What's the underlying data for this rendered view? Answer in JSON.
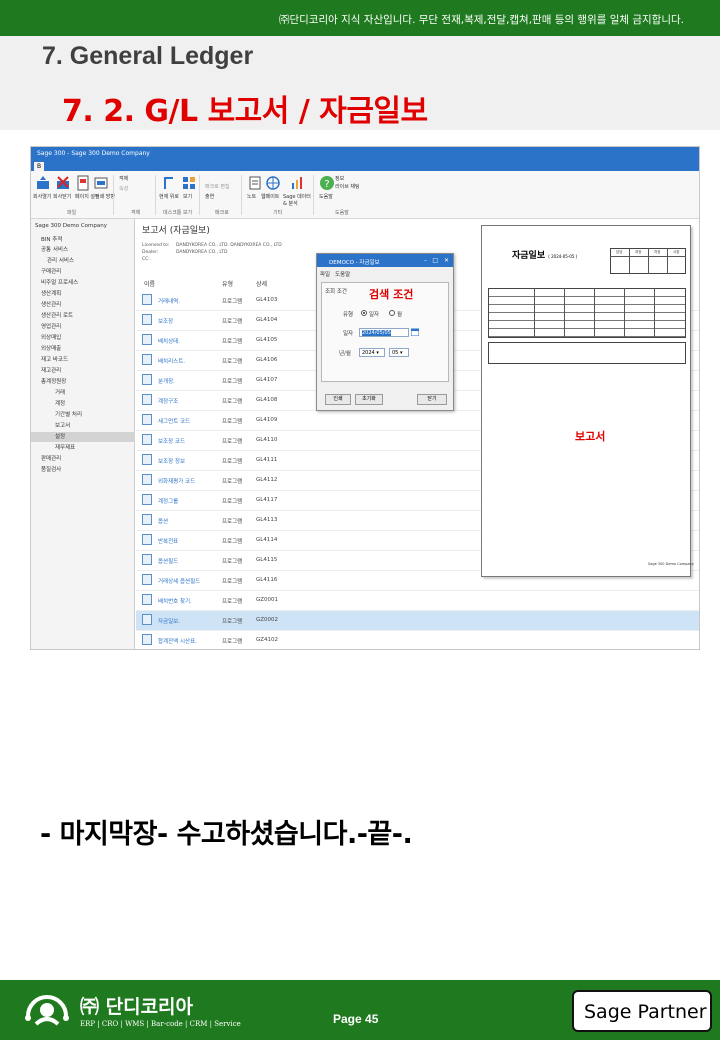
{
  "header": {
    "notice": "㈜단디코리아 지식 자산입니다. 무단 전재,복제,전달,캡쳐,판매 등의 행위를 일체 금지합니다.",
    "chapter": "7. General Ledger",
    "section": "7. 2. G/L 보고서 / 자금일보"
  },
  "screenshot": {
    "window_title": "Sage 300 - Sage 300 Demo Company",
    "home_tab": "B",
    "ribbon": {
      "buttons": [
        {
          "label": "회사열기",
          "icon": "open-company-icon"
        },
        {
          "label": "회사닫기",
          "icon": "close-company-icon"
        },
        {
          "label": "페이지 설정",
          "icon": "page-setup-icon"
        },
        {
          "label": "인쇄 방향",
          "icon": "print-orientation-icon"
        },
        {
          "label": "객체",
          "icon": "object-icon"
        },
        {
          "label": "속성",
          "icon": "properties-icon"
        },
        {
          "label": "현재 위로",
          "icon": "move-up-icon"
        },
        {
          "label": "보기",
          "icon": "view-icon"
        },
        {
          "label": "매크로 편집",
          "icon": "macro-edit-icon"
        },
        {
          "label": "출연",
          "icon": "macro-run-icon"
        },
        {
          "label": "노트",
          "icon": "note-icon"
        },
        {
          "label": "웹페이트",
          "icon": "web-icon"
        },
        {
          "label": "Sage 데이터 & 분석",
          "icon": "analytics-icon"
        },
        {
          "label": "도움말",
          "icon": "help-icon"
        },
        {
          "label": "정보",
          "icon": "info-icon"
        },
        {
          "label": "라이브 채팅",
          "icon": "live-chat-icon"
        }
      ],
      "groups": [
        "파일",
        "객체",
        "데스크톱 보기",
        "매크로",
        "기타",
        "도움말"
      ]
    },
    "sidebar": {
      "root": "Sage 300 Demo Company",
      "items": [
        "BIN 추적",
        "공통 서비스",
        "관리 서비스",
        "구매관리",
        "비주얼 프로세스",
        "생산계획",
        "생산관리",
        "생산관리 로트",
        "영업관리",
        "외상매입",
        "외상매출",
        "재고 바코드",
        "재고관리",
        "총계정원장"
      ],
      "sub_items": [
        "거래",
        "계정",
        "기간별 처리",
        "보고서",
        "설정",
        "재무제표"
      ],
      "tail_items": [
        "판매관리",
        "품질검사"
      ],
      "selected": "보고서"
    },
    "content": {
      "title": "보고서 (자금일보)",
      "licensed_label": "Licensed to:",
      "licensed_value": "DANDYKOREA CO., LTD. DANDYKOREA CO., LTD",
      "dealer_label": "Dealer:",
      "dealer_value": "DANDYKOREA CO., LTD",
      "cc_label": "CC:",
      "columns": [
        "이름",
        "유형",
        "상세"
      ],
      "rows": [
        {
          "name": "거래내역.",
          "type": "프로그램",
          "code": "GL4103"
        },
        {
          "name": "보조장",
          "type": "프로그램",
          "code": "GL4104"
        },
        {
          "name": "배치상태.",
          "type": "프로그램",
          "code": "GL4105"
        },
        {
          "name": "배치리스트.",
          "type": "프로그램",
          "code": "GL4106"
        },
        {
          "name": "분개장.",
          "type": "프로그램",
          "code": "GL4107"
        },
        {
          "name": "계정구조",
          "type": "프로그램",
          "code": "GL4108"
        },
        {
          "name": "세그먼트 코드",
          "type": "프로그램",
          "code": "GL4109"
        },
        {
          "name": "보조장 코드",
          "type": "프로그램",
          "code": "GL4110"
        },
        {
          "name": "보조장 정보",
          "type": "프로그램",
          "code": "GL4111"
        },
        {
          "name": "외화재평가 코드",
          "type": "프로그램",
          "code": "GL4112"
        },
        {
          "name": "계정그룹",
          "type": "프로그램",
          "code": "GL4117"
        },
        {
          "name": "옵션",
          "type": "프로그램",
          "code": "GL4113"
        },
        {
          "name": "반복전표",
          "type": "프로그램",
          "code": "GL4114"
        },
        {
          "name": "옵션필드",
          "type": "프로그램",
          "code": "GL4115"
        },
        {
          "name": "거래상세 옵션필드",
          "type": "프로그램",
          "code": "GL4116"
        },
        {
          "name": "배치번호 찾기.",
          "type": "프로그램",
          "code": "GZ0001"
        },
        {
          "name": "자금일보.",
          "type": "프로그램",
          "code": "GZ0002",
          "selected": true
        },
        {
          "name": "합계잔액 시산표.",
          "type": "프로그램",
          "code": "GZ4102"
        }
      ]
    },
    "dialog": {
      "title": "DEMOCO - 자금일보",
      "menu": [
        "파일",
        "도움말"
      ],
      "tab": "조회 조건",
      "annotation": "검색 조건",
      "type_label": "유형",
      "radio_daily": "일자",
      "radio_monthly": "월",
      "date_label": "일자",
      "date_value": "2024/05/05",
      "yearmonth_label": "년/월",
      "year_value": "2024",
      "month_value": "05",
      "btn_print": "인쇄",
      "btn_reset": "초기화",
      "btn_close": "닫기"
    },
    "preview": {
      "title": "자금일보",
      "subtitle": "( 2024-05-05 )",
      "annotation": "보고서",
      "approval_cols": [
        "담당",
        "과장",
        "차장",
        "사장"
      ],
      "footer_text": "Sage 300 Demo Company"
    }
  },
  "closing": "- 마지막장- 수고하셨습니다.-끝-.",
  "footer": {
    "brand": "㈜ 단디코리아",
    "tagline": "ERP | CRO | WMS | Bar-code | CRM | Service",
    "page": "Page 45",
    "partner": "Sage Partner"
  },
  "colors": {
    "brand_green": "#1f7a1f",
    "accent_red": "#e00000",
    "sage_blue": "#2b73c9"
  }
}
